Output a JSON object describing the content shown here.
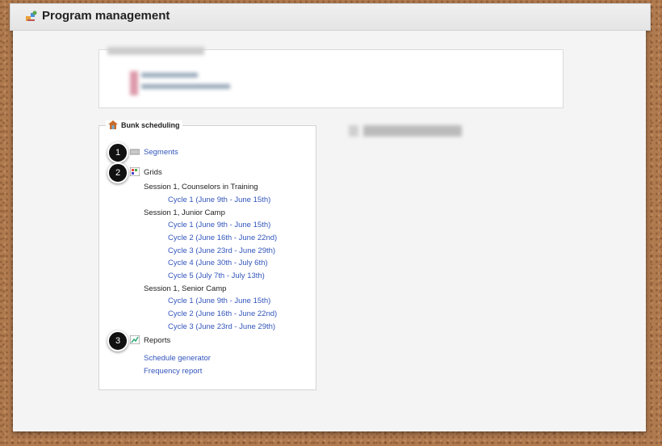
{
  "header": {
    "title": "Program management"
  },
  "bunk_scheduling": {
    "title": "Bunk scheduling",
    "segments_label": "Segments",
    "grids_label": "Grids",
    "sessions": [
      {
        "name": "Session 1, Counselors in Training",
        "cycles": [
          "Cycle 1 (June 9th - June 15th)"
        ]
      },
      {
        "name": "Session 1, Junior Camp",
        "cycles": [
          "Cycle 1 (June 9th - June 15th)",
          "Cycle 2 (June 16th - June 22nd)",
          "Cycle 3 (June 23rd - June 29th)",
          "Cycle 4 (June 30th - July 6th)",
          "Cycle 5 (July 7th - July 13th)"
        ]
      },
      {
        "name": "Session 1, Senior Camp",
        "cycles": [
          "Cycle 1 (June 9th - June 15th)",
          "Cycle 2 (June 16th - June 22nd)",
          "Cycle 3 (June 23rd - June 29th)"
        ]
      }
    ],
    "reports_label": "Reports",
    "reports": [
      "Schedule generator",
      "Frequency report"
    ]
  },
  "markers": [
    "1",
    "2",
    "3"
  ],
  "colors": {
    "link": "#3355bb",
    "marker": "#111111",
    "background": "#b07a4f"
  }
}
